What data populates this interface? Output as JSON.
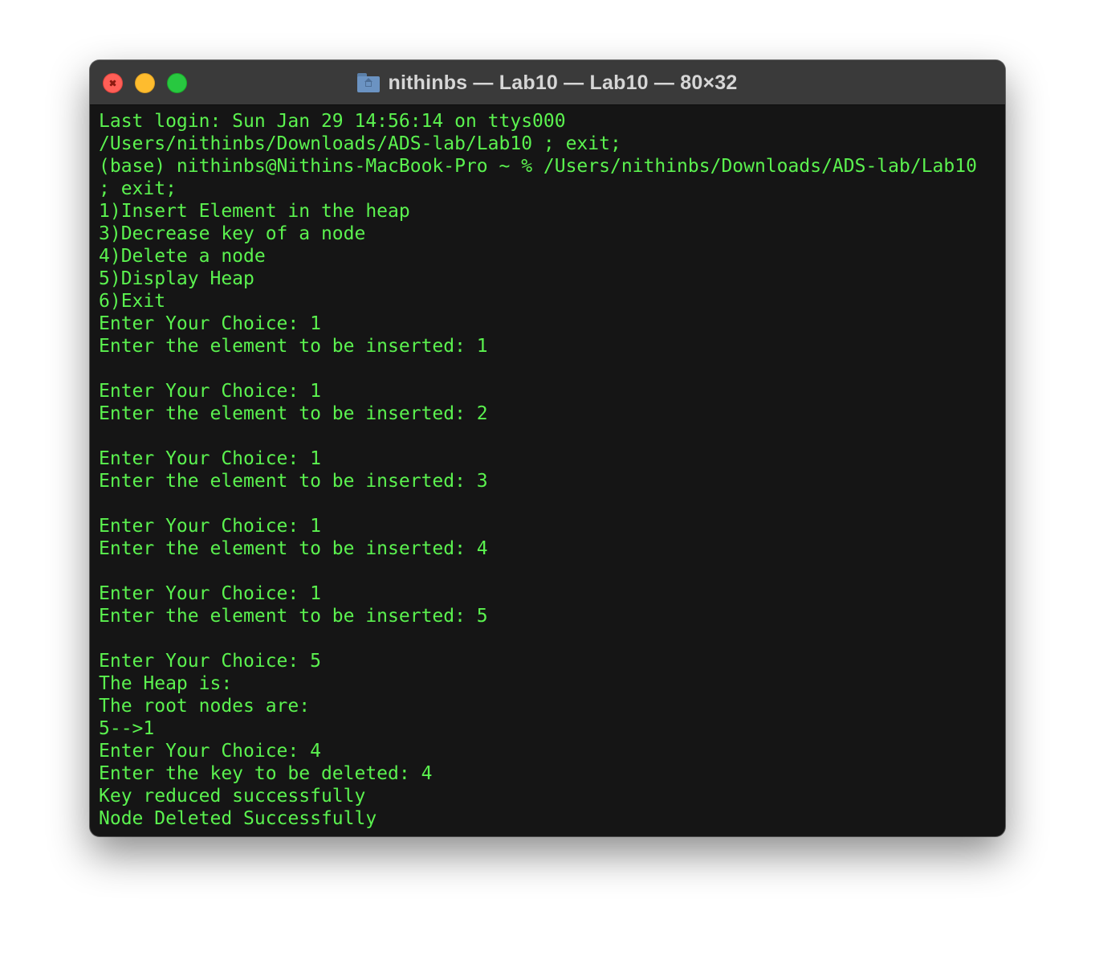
{
  "window": {
    "title": "nithinbs — Lab10 — Lab10 — 80×32",
    "folder_icon": "home-folder-icon"
  },
  "terminal": {
    "lines": [
      "Last login: Sun Jan 29 14:56:14 on ttys000",
      "/Users/nithinbs/Downloads/ADS-lab/Lab10 ; exit;",
      "(base) nithinbs@Nithins-MacBook-Pro ~ % /Users/nithinbs/Downloads/ADS-lab/Lab10",
      "; exit;",
      "1)Insert Element in the heap",
      "3)Decrease key of a node",
      "4)Delete a node",
      "5)Display Heap",
      "6)Exit",
      "Enter Your Choice: 1",
      "Enter the element to be inserted: 1",
      "",
      "Enter Your Choice: 1",
      "Enter the element to be inserted: 2",
      "",
      "Enter Your Choice: 1",
      "Enter the element to be inserted: 3",
      "",
      "Enter Your Choice: 1",
      "Enter the element to be inserted: 4",
      "",
      "Enter Your Choice: 1",
      "Enter the element to be inserted: 5",
      "",
      "Enter Your Choice: 5",
      "The Heap is:",
      "The root nodes are:",
      "5-->1",
      "Enter Your Choice: 4",
      "Enter the key to be deleted: 4",
      "Key reduced successfully",
      "Node Deleted Successfully"
    ]
  },
  "colors": {
    "text": "#5bf24f",
    "background": "#151515",
    "titlebar": "#3a3a3a"
  }
}
